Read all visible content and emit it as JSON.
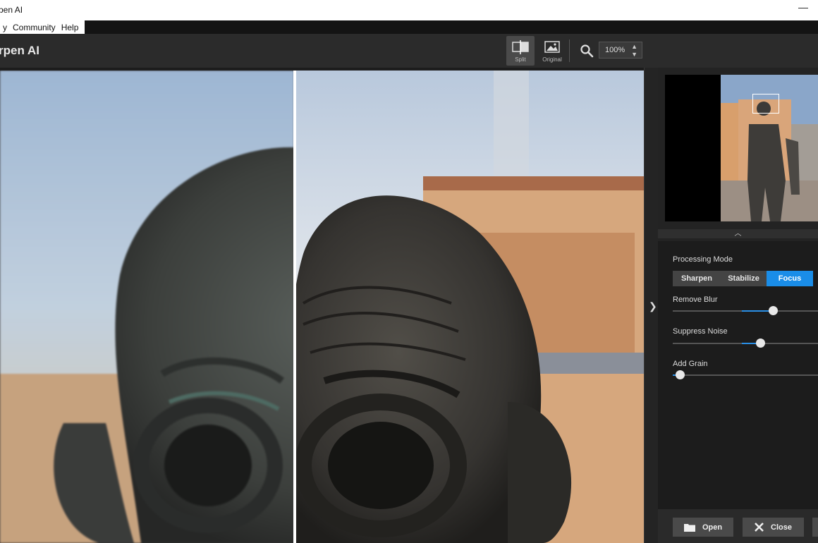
{
  "window": {
    "title": "pen AI",
    "minimize": "—"
  },
  "menu": {
    "items": [
      "y",
      "Community",
      "Help"
    ]
  },
  "header": {
    "app_title": "rpen AI"
  },
  "toolbar": {
    "split_label": "Split",
    "original_label": "Original",
    "zoom_value": "100%"
  },
  "panel": {
    "processing_mode_label": "Processing Mode",
    "modes": [
      {
        "label": "Sharpen",
        "selected": false
      },
      {
        "label": "Stabilize",
        "selected": false
      },
      {
        "label": "Focus",
        "selected": true
      }
    ],
    "sliders": [
      {
        "label": "Remove Blur",
        "value": 0.69
      },
      {
        "label": "Suppress Noise",
        "value": 0.6
      },
      {
        "label": "Add Grain",
        "value": 0.05
      }
    ]
  },
  "footer": {
    "open_label": "Open",
    "close_label": "Close"
  },
  "colors": {
    "accent": "#1a8de8"
  }
}
